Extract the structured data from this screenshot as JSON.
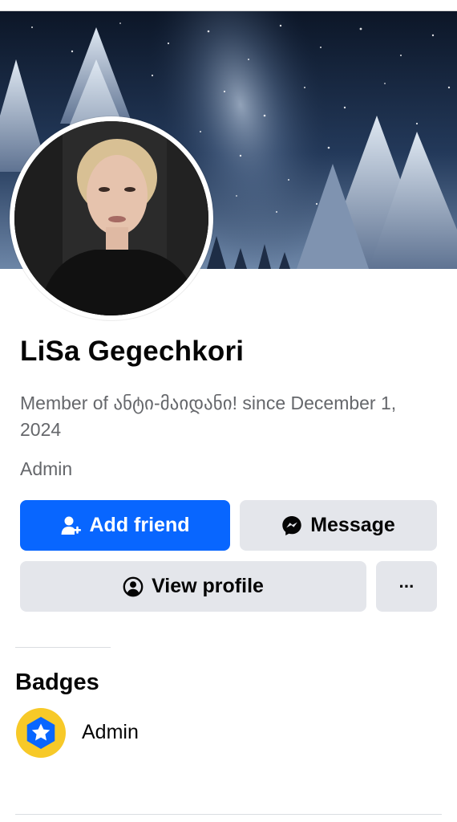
{
  "profile": {
    "name": "LiSa Gegechkori",
    "member_since": "Member of ანტი-მაიდანი! since December 1, 2024",
    "role": "Admin"
  },
  "actions": {
    "add_friend": "Add friend",
    "message": "Message",
    "view_profile": "View profile",
    "more": "···"
  },
  "badges": {
    "title": "Badges",
    "items": [
      {
        "label": "Admin",
        "icon": "star-shield-icon"
      }
    ]
  },
  "colors": {
    "primary": "#0866ff",
    "secondary_button": "#e4e6eb",
    "muted_text": "#65676b",
    "badge_outer": "#f7c928",
    "badge_inner": "#0866ff"
  }
}
